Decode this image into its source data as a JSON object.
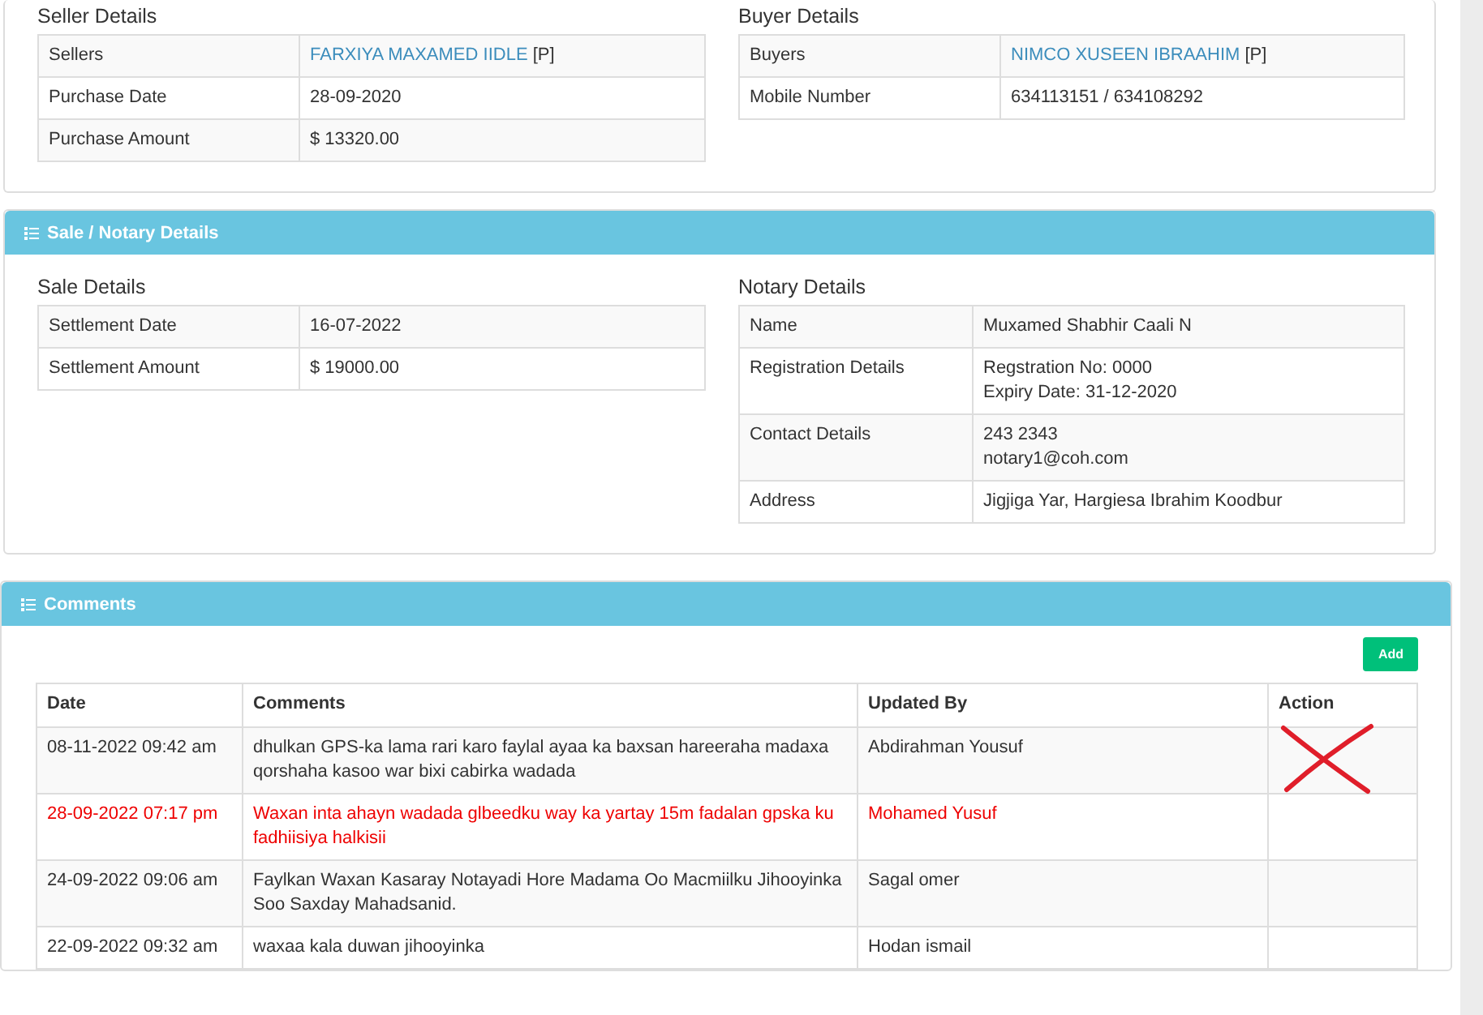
{
  "party_panel": {
    "sections": [
      {
        "title": "Seller Details",
        "rows": [
          {
            "label": "Sellers",
            "kind": "link",
            "link": "FARXIYA MAXAMED IIDLE",
            "suffix": "[P]"
          },
          {
            "label": "Purchase Date",
            "kind": "text",
            "lines": [
              "28-09-2020"
            ]
          },
          {
            "label": "Purchase Amount",
            "kind": "text",
            "lines": [
              "$ 13320.00"
            ]
          }
        ]
      },
      {
        "title": "Buyer Details",
        "rows": [
          {
            "label": "Buyers",
            "kind": "link",
            "link": "NIMCO XUSEEN IBRAAHIM",
            "suffix": "[P]"
          },
          {
            "label": "Mobile Number",
            "kind": "text",
            "lines": [
              "634113151 / 634108292"
            ]
          }
        ]
      }
    ]
  },
  "sale_panel": {
    "title": "Sale / Notary Details",
    "sections": [
      {
        "title": "Sale Details",
        "rows": [
          {
            "label": "Settlement Date",
            "kind": "text",
            "lines": [
              "16-07-2022"
            ]
          },
          {
            "label": "Settlement Amount",
            "kind": "text",
            "lines": [
              "$ 19000.00"
            ]
          }
        ]
      },
      {
        "title": "Notary Details",
        "rows": [
          {
            "label": "Name",
            "kind": "text",
            "lines": [
              "Muxamed Shabhir Caali N"
            ]
          },
          {
            "label": "Registration Details",
            "kind": "text",
            "lines": [
              "Regstration No: 0000",
              "Expiry Date: 31-12-2020"
            ]
          },
          {
            "label": "Contact Details",
            "kind": "text",
            "lines": [
              "243 2343",
              "notary1@coh.com"
            ]
          },
          {
            "label": "Address",
            "kind": "text",
            "lines": [
              "Jigjiga Yar, Hargiesa Ibrahim Koodbur"
            ]
          }
        ]
      }
    ]
  },
  "comments_panel": {
    "title": "Comments",
    "add_button": "Add",
    "columns": [
      "Date",
      "Comments",
      "Updated By",
      "Action"
    ],
    "rows": [
      {
        "date": "08-11-2022 09:42 am",
        "comment": "dhulkan GPS-ka lama rari karo faylal ayaa ka baxsan hareeraha madaxa qorshaha kasoo war bixi cabirka wadada",
        "updated_by": "Abdirahman Yousuf",
        "flagged": false,
        "crossed_out": true
      },
      {
        "date": "28-09-2022 07:17 pm",
        "comment": "Waxan inta ahayn wadada glbeedku way ka yartay 15m fadalan gpska ku fadhiisiya halkisii",
        "updated_by": "Mohamed Yusuf",
        "flagged": true,
        "crossed_out": false
      },
      {
        "date": "24-09-2022 09:06 am",
        "comment": "Faylkan Waxan Kasaray Notayadi Hore Madama Oo Macmiilku Jihooyinka Soo Saxday Mahadsanid.",
        "updated_by": "Sagal omer",
        "flagged": false,
        "crossed_out": false
      },
      {
        "date": "22-09-2022 09:32 am",
        "comment": "waxaa kala duwan jihooyinka",
        "updated_by": "Hodan ismail",
        "flagged": false,
        "crossed_out": false
      }
    ]
  }
}
